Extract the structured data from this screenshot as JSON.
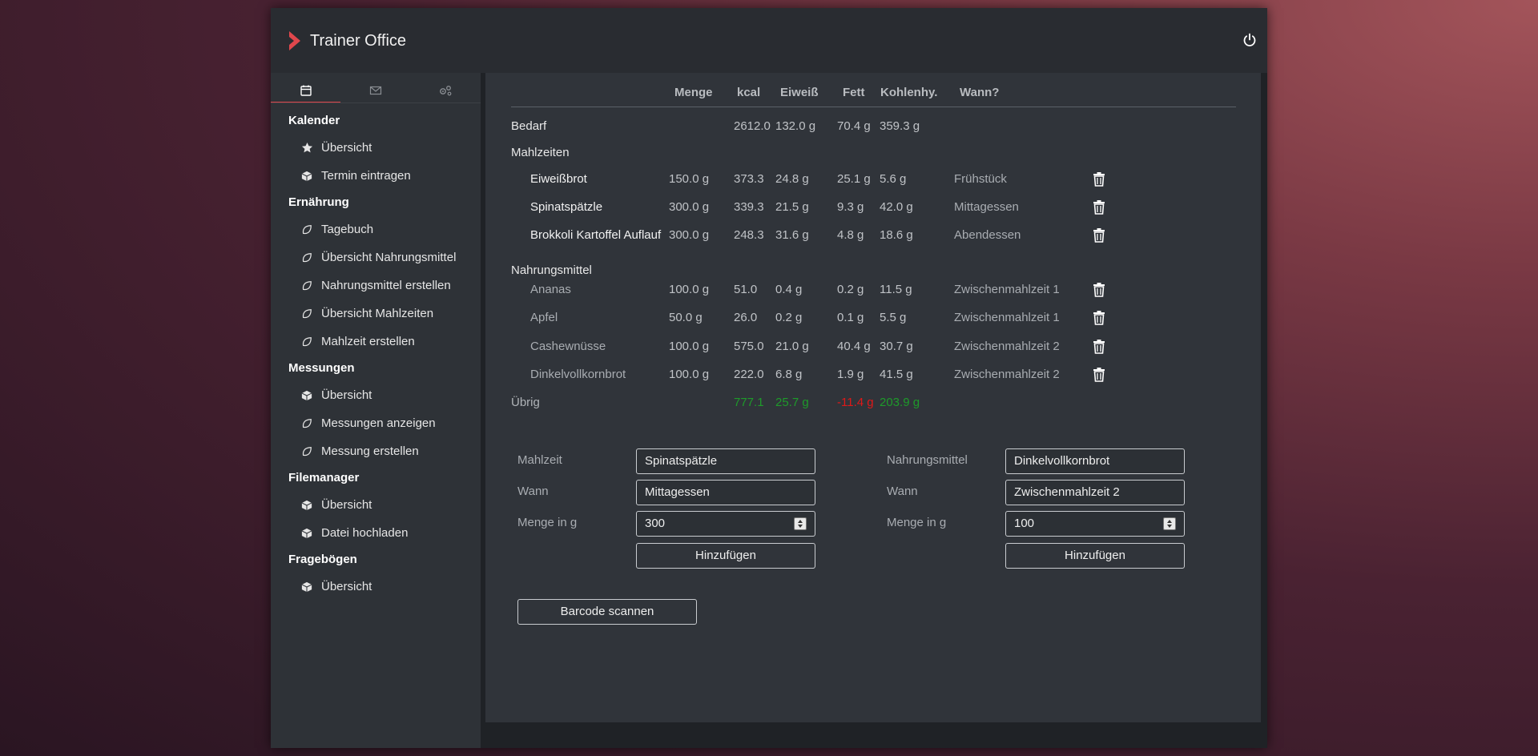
{
  "app": {
    "title": "Trainer Office",
    "accent": "#e0474c"
  },
  "sidebar": {
    "tabs": [
      "calendar-icon",
      "mail-icon",
      "settings-icon"
    ],
    "sections": [
      {
        "title": "Kalender",
        "items": [
          {
            "label": "Übersicht",
            "icon": "star-icon"
          },
          {
            "label": "Termin eintragen",
            "icon": "cube-icon"
          }
        ]
      },
      {
        "title": "Ernährung",
        "items": [
          {
            "label": "Tagebuch",
            "icon": "leaf-icon"
          },
          {
            "label": "Übersicht Nahrungsmittel",
            "icon": "leaf-icon"
          },
          {
            "label": "Nahrungsmittel erstellen",
            "icon": "leaf-icon"
          },
          {
            "label": "Übersicht Mahlzeiten",
            "icon": "leaf-icon"
          },
          {
            "label": "Mahlzeit erstellen",
            "icon": "leaf-icon"
          }
        ]
      },
      {
        "title": "Messungen",
        "items": [
          {
            "label": "Übersicht",
            "icon": "cube-icon"
          },
          {
            "label": "Messungen anzeigen",
            "icon": "leaf-icon"
          },
          {
            "label": "Messung erstellen",
            "icon": "leaf-icon"
          }
        ]
      },
      {
        "title": "Filemanager",
        "items": [
          {
            "label": "Übersicht",
            "icon": "cube-icon"
          },
          {
            "label": "Datei hochladen",
            "icon": "cube-icon"
          }
        ]
      },
      {
        "title": "Fragebögen",
        "items": [
          {
            "label": "Übersicht",
            "icon": "cube-icon"
          }
        ]
      }
    ]
  },
  "table": {
    "headers": {
      "menge": "Menge",
      "kcal": "kcal",
      "eiweiss": "Eiweiß",
      "fett": "Fett",
      "kohlen": "Kohlenhy.",
      "wann": "Wann?"
    },
    "bedarf": {
      "label": "Bedarf",
      "kcal": "2612.0",
      "eiweiss": "132.0 g",
      "fett": "70.4 g",
      "kohlen": "359.3 g"
    },
    "meals_label": "Mahlzeiten",
    "meals": [
      {
        "name": "Eiweißbrot",
        "menge": "150.0 g",
        "kcal": "373.3",
        "eiweiss": "24.8 g",
        "fett": "25.1 g",
        "kohlen": "5.6 g",
        "wann": "Frühstück"
      },
      {
        "name": "Spinatspätzle",
        "menge": "300.0 g",
        "kcal": "339.3",
        "eiweiss": "21.5 g",
        "fett": "9.3 g",
        "kohlen": "42.0 g",
        "wann": "Mittagessen"
      },
      {
        "name": "Brokkoli Kartoffel Auflauf",
        "menge": "300.0 g",
        "kcal": "248.3",
        "eiweiss": "31.6 g",
        "fett": "4.8 g",
        "kohlen": "18.6 g",
        "wann": "Abendessen"
      }
    ],
    "foods_label": "Nahrungsmittel",
    "foods": [
      {
        "name": "Ananas",
        "menge": "100.0 g",
        "kcal": "51.0",
        "eiweiss": "0.4 g",
        "fett": "0.2 g",
        "kohlen": "11.5 g",
        "wann": "Zwischenmahlzeit 1"
      },
      {
        "name": "Apfel",
        "menge": "50.0 g",
        "kcal": "26.0",
        "eiweiss": "0.2 g",
        "fett": "0.1 g",
        "kohlen": "5.5 g",
        "wann": "Zwischenmahlzeit 1"
      },
      {
        "name": "Cashewnüsse",
        "menge": "100.0 g",
        "kcal": "575.0",
        "eiweiss": "21.0 g",
        "fett": "40.4 g",
        "kohlen": "30.7 g",
        "wann": "Zwischenmahlzeit 2"
      },
      {
        "name": "Dinkelvollkornbrot",
        "menge": "100.0 g",
        "kcal": "222.0",
        "eiweiss": "6.8 g",
        "fett": "1.9 g",
        "kohlen": "41.5 g",
        "wann": "Zwischenmahlzeit 2"
      }
    ],
    "uebrig": {
      "label": "Übrig",
      "kcal": "777.1",
      "eiweiss": "25.7 g",
      "fett": "-11.4 g",
      "kohlen": "203.9 g"
    },
    "colors": {
      "positive": "#1e9a2a",
      "negative": "#e01818"
    }
  },
  "form_meal": {
    "label_mahlzeit": "Mahlzeit",
    "mahlzeit_value": "Spinatspätzle",
    "label_wann": "Wann",
    "wann_value": "Mittagessen",
    "label_menge": "Menge in g",
    "menge_value": "300",
    "add_label": "Hinzufügen"
  },
  "form_food": {
    "label_nahrungsmittel": "Nahrungsmittel",
    "nahrungsmittel_value": "Dinkelvollkornbrot",
    "label_wann": "Wann",
    "wann_value": "Zwischenmahlzeit 2",
    "label_menge": "Menge in g",
    "menge_value": "100",
    "add_label": "Hinzufügen"
  },
  "barcode_label": "Barcode scannen"
}
